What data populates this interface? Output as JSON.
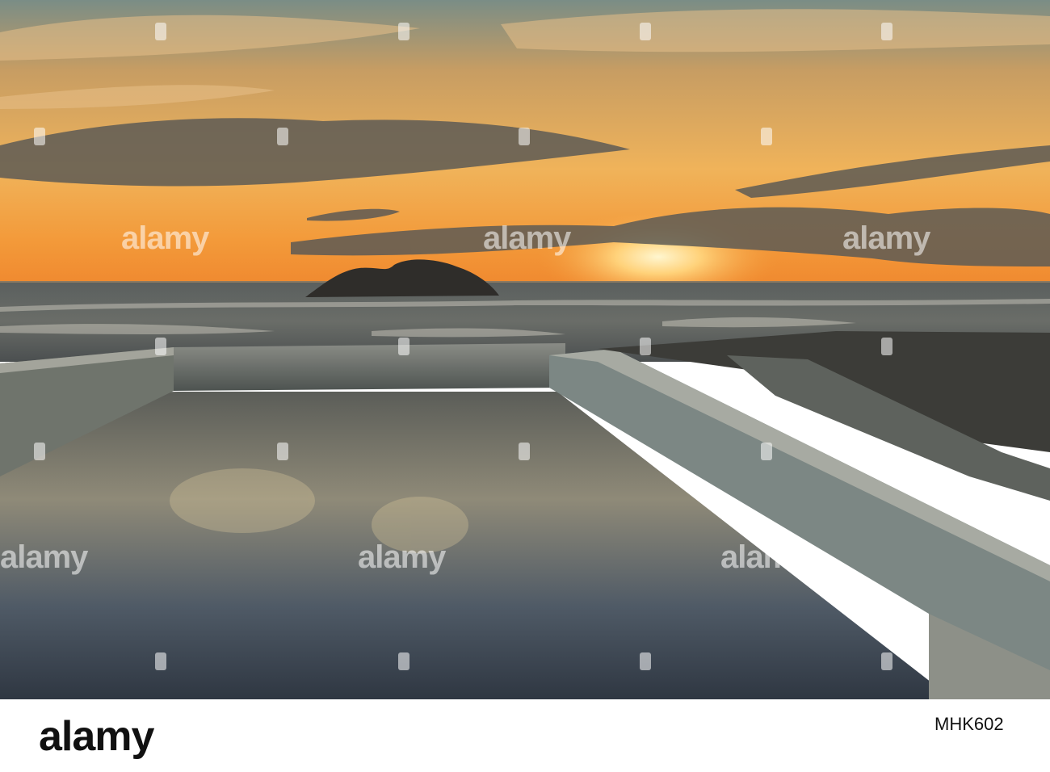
{
  "watermark": {
    "text": "alamy"
  },
  "footer": {
    "logo": "alamy",
    "image_id": "MHK602"
  }
}
